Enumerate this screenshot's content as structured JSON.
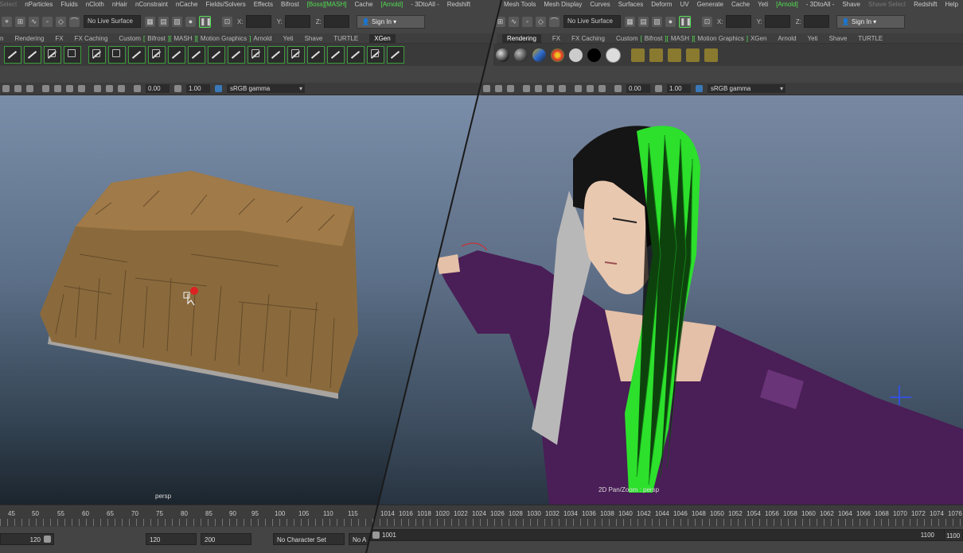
{
  "left": {
    "menu": [
      "Select",
      "nParticles",
      "Fluids",
      "nCloth",
      "nHair",
      "nConstraint",
      "nCache",
      "Fields/Solvers",
      "Effects",
      "Bifrost",
      "[Boss]",
      "[MASH]",
      "Cache",
      "[Arnold]",
      "- 3DtoAll -",
      "Redshift"
    ],
    "status": {
      "live_surface": "No Live Surface",
      "x_label": "X:",
      "y_label": "Y:",
      "z_label": "Z:",
      "sign_in": "Sign In"
    },
    "shelf_tabs": [
      "n",
      "Rendering",
      "FX",
      "FX Caching",
      "Custom",
      "Bifrost",
      "MASH",
      "Motion Graphics",
      "Arnold",
      "Yeti",
      "Shave",
      "TURTLE",
      "XGen"
    ],
    "panel": {
      "val1": "0.00",
      "val2": "1.00",
      "colorspace": "sRGB gamma"
    },
    "camera": "persp",
    "ticks": [
      "45",
      "50",
      "55",
      "60",
      "65",
      "70",
      "75",
      "80",
      "85",
      "90",
      "95",
      "100",
      "105",
      "110",
      "115"
    ],
    "range": {
      "start": "120",
      "end": "120",
      "end2": "200",
      "charset": "No Character Set",
      "anim": "No A"
    }
  },
  "right": {
    "menu": [
      "Mesh Tools",
      "Mesh Display",
      "Curves",
      "Surfaces",
      "Deform",
      "UV",
      "Generate",
      "Cache",
      "Yeti",
      "[Arnold]",
      "- 3DtoAll -",
      "Shave",
      "Shave Select",
      "Redshift",
      "Help"
    ],
    "status": {
      "live_surface": "No Live Surface",
      "x_label": "X:",
      "y_label": "Y:",
      "z_label": "Z:",
      "sign_in": "Sign In"
    },
    "shelf_tabs": [
      "Rendering",
      "FX",
      "FX Caching",
      "Custom",
      "Bifrost",
      "MASH",
      "Motion Graphics",
      "XGen",
      "Arnold",
      "Yeti",
      "Shave",
      "TURTLE"
    ],
    "panel": {
      "val1": "0.00",
      "val2": "1.00",
      "colorspace": "sRGB gamma"
    },
    "camera": "2D Pan/Zoom : persp",
    "ticks": [
      "1014",
      "1016",
      "1018",
      "1020",
      "1022",
      "1024",
      "1026",
      "1028",
      "1030",
      "1032",
      "1034",
      "1036",
      "1038",
      "1040",
      "1042",
      "1044",
      "1046",
      "1048",
      "1050",
      "1052",
      "1054",
      "1056",
      "1058",
      "1060",
      "1062",
      "1064",
      "1066",
      "1068",
      "1070",
      "1072",
      "1074",
      "1076"
    ],
    "range": {
      "start": "1001",
      "end": "1100",
      "end2": "1100"
    }
  },
  "colors": {
    "accent_green": "#52e052",
    "hair_green": "#2ce02c",
    "grass": "#8a6a3c"
  }
}
